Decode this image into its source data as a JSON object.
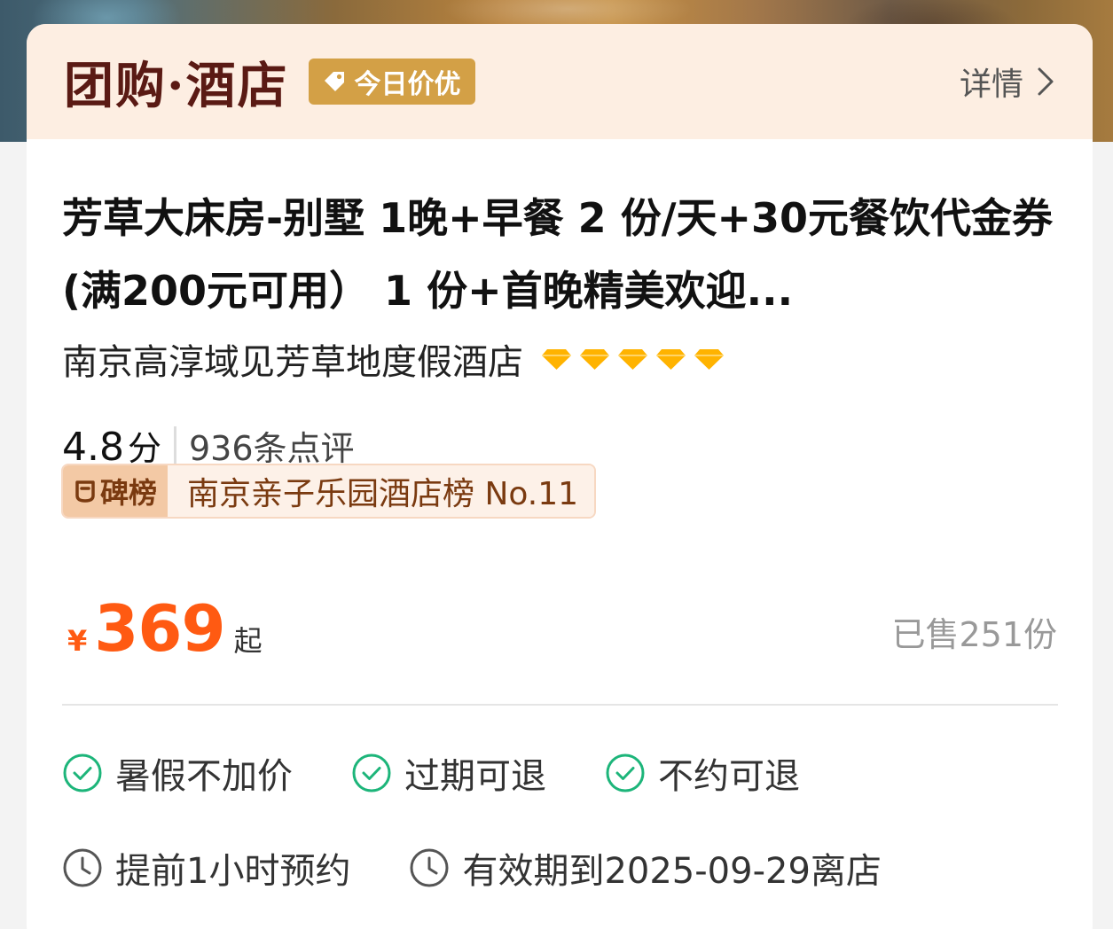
{
  "header": {
    "brand": "团购·酒店",
    "deal_badge": "今日价优",
    "details_link": "详情"
  },
  "deal": {
    "title": "芳草大床房-别墅 1晚+早餐 2 份/天+30元餐饮代金券(满200元可用） 1 份+首晚精美欢迎...",
    "hotel_name": "南京高淳域见芳草地度假酒店",
    "diamond_count": 5,
    "score": "4.8",
    "score_unit": "分",
    "reviews": "936条点评",
    "rank_label": "碑榜",
    "rank_text": "南京亲子乐园酒店榜 No.11",
    "currency": "¥",
    "price": "369",
    "price_suffix": "起",
    "sold": "已售251份"
  },
  "features": [
    {
      "label": "暑假不加价",
      "icon": "check-circle-icon"
    },
    {
      "label": "过期可退",
      "icon": "check-circle-icon"
    },
    {
      "label": "不约可退",
      "icon": "check-circle-icon"
    }
  ],
  "info": [
    {
      "label": "提前1小时预约",
      "icon": "clock-icon"
    },
    {
      "label": "有效期到2025-09-29离店",
      "icon": "clock-icon"
    }
  ],
  "colors": {
    "price": "#ff5a12",
    "check": "#1db57a",
    "header_bg": "#fdeee2",
    "badge_bg": "#d3a046",
    "diamond": "#ffb300",
    "brand": "#5a1a14"
  }
}
